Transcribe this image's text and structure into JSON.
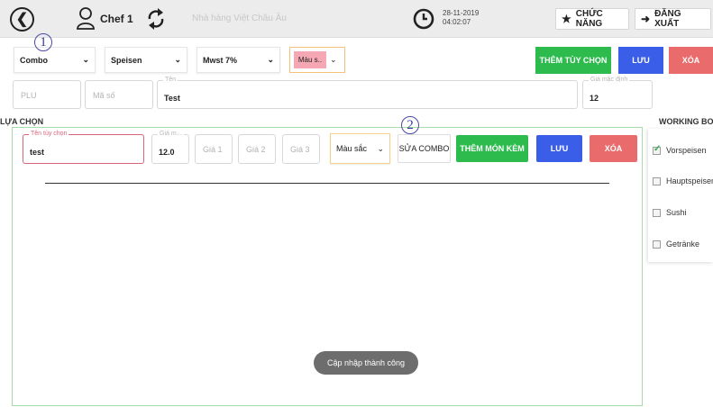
{
  "header": {
    "user_name": "Chef 1",
    "faded_text": "Nhà hàng Việt Châu Âu",
    "date": "28-11-2019",
    "time": "04:02:07",
    "functions_label": "CHỨC NĂNG",
    "logout_label": "ĐĂNG XUẤT"
  },
  "filters": {
    "type_value": "Combo",
    "category_value": "Speisen",
    "tax_value": "Mwst 7%",
    "color_value": "Màu s..",
    "color_chip": "#f5a8b4"
  },
  "top_actions": {
    "add_option_label": "THÊM TÙY CHỌN",
    "save_label": "LƯU",
    "delete_label": "XÓA",
    "add_option_color": "#2dbb4e",
    "save_color": "#3b5ee8",
    "delete_color": "#ea6b6b"
  },
  "item_fields": {
    "plu_placeholder": "PLU",
    "code_placeholder": "Mã số",
    "name_label": "Tên",
    "name_value": "Test",
    "default_price_label": "Giá mặc định",
    "default_price_value": "12"
  },
  "annotations": {
    "first": "1",
    "second": "2"
  },
  "section_title": "LỰA CHỌN",
  "option_row": {
    "option_name_label": "Tên tùy chọn",
    "option_name_value": "test",
    "price_label": "Giá m...",
    "price_value": "12.0",
    "price1_placeholder": "Giá 1",
    "price2_placeholder": "Giá 2",
    "price3_placeholder": "Giá 3",
    "color_label": "Màu sắc",
    "edit_combo_label": "SỬA COMBO",
    "add_side_label": "THÊM MÓN KÈM",
    "save_label": "LƯU",
    "delete_label": "XÓA"
  },
  "toast": "Cập nhập thành công",
  "working": {
    "title": "WORKING BO",
    "items": [
      {
        "label": "Vorspeisen",
        "checked": true
      },
      {
        "label": "Hauptspeisen",
        "checked": false
      },
      {
        "label": "Sushi",
        "checked": false
      },
      {
        "label": "Getränke",
        "checked": false
      }
    ]
  }
}
